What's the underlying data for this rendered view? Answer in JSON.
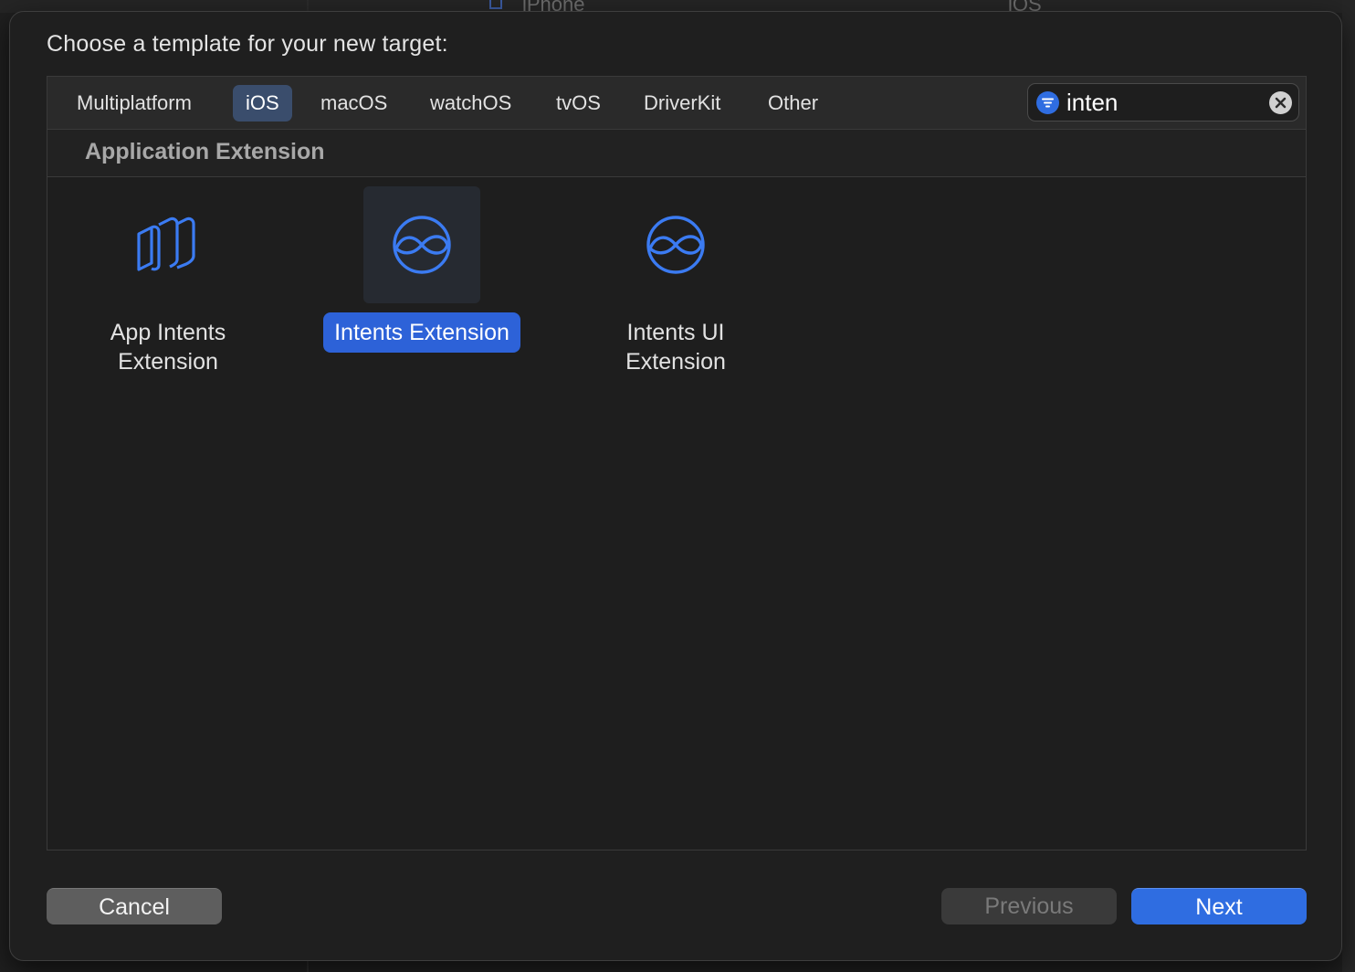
{
  "background": {
    "left_label": "iPhone",
    "right_label": "iOS"
  },
  "dialog": {
    "title": "Choose a template for your new target:"
  },
  "tabs": [
    {
      "label": "Multiplatform",
      "active": false
    },
    {
      "label": "iOS",
      "active": true
    },
    {
      "label": "macOS",
      "active": false
    },
    {
      "label": "watchOS",
      "active": false
    },
    {
      "label": "tvOS",
      "active": false
    },
    {
      "label": "DriverKit",
      "active": false
    },
    {
      "label": "Other",
      "active": false
    }
  ],
  "search": {
    "value": "inten",
    "filter_icon": "filter-icon",
    "clear_icon": "clear-icon"
  },
  "section": {
    "title": "Application Extension"
  },
  "templates": [
    {
      "line1": "App Intents",
      "line2": "Extension",
      "icon": "app-intents-icon",
      "selected": false
    },
    {
      "label": "Intents Extension",
      "icon": "intents-icon",
      "selected": true
    },
    {
      "line1": "Intents UI",
      "line2": "Extension",
      "icon": "intents-ui-icon",
      "selected": false
    }
  ],
  "buttons": {
    "cancel": "Cancel",
    "previous": "Previous",
    "next": "Next"
  },
  "colors": {
    "accent": "#2f6de1",
    "selection": "#2d62d8",
    "active_tab": "#3a4d6c",
    "icon": "#3b7bf2"
  }
}
